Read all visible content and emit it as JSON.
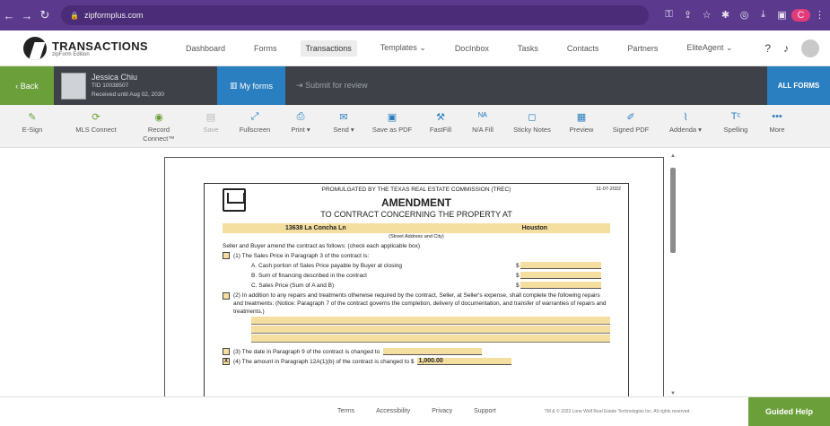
{
  "browser": {
    "url": "zipformplus.com",
    "profile_initial": "C"
  },
  "header": {
    "brand_title": "TRANSACTIONS",
    "brand_subtitle": "zipForm Edition",
    "nav": [
      "Dashboard",
      "Forms",
      "Transactions",
      "Templates",
      "DocInbox",
      "Tasks",
      "Contacts",
      "Partners",
      "EliteAgent"
    ],
    "active_nav": "Transactions"
  },
  "form_bar": {
    "back_label": "Back",
    "user_name": "Jessica Chiu",
    "user_id": "TID 10038507",
    "received_line": "Received until Aug 02, 2030",
    "my_forms_label": "My forms",
    "submit_label": "Submit for review",
    "all_forms_label": "ALL FORMS"
  },
  "toolbar": {
    "tools": [
      {
        "label": "E-Sign",
        "icon": "pen-icon"
      },
      {
        "label": "MLS Connect",
        "icon": "mls-icon"
      },
      {
        "label": "Record",
        "sub": "Connect™",
        "icon": "record-icon"
      },
      {
        "label": "Save",
        "icon": "save-icon"
      },
      {
        "label": "Fullscreen",
        "icon": "fullscreen-icon"
      },
      {
        "label": "Print",
        "icon": "print-icon"
      },
      {
        "label": "Send",
        "icon": "send-icon"
      },
      {
        "label": "Save as PDF",
        "icon": "pdf-icon"
      },
      {
        "label": "FastFill",
        "icon": "wrench-icon"
      },
      {
        "label": "N/A Fill",
        "icon": "na-icon"
      },
      {
        "label": "Sticky Notes",
        "icon": "note-icon"
      },
      {
        "label": "Preview",
        "icon": "preview-icon"
      },
      {
        "label": "Signed PDF",
        "icon": "signed-icon"
      },
      {
        "label": "Addenda",
        "icon": "clip-icon"
      },
      {
        "label": "Spelling",
        "icon": "spell-icon"
      },
      {
        "label": "More",
        "icon": "more-icon"
      }
    ]
  },
  "document": {
    "promulgated": "PROMULGATED BY THE TEXAS REAL ESTATE COMMISSION (TREC)",
    "form_date": "11-07-2022",
    "title": "AMENDMENT",
    "subtitle": "TO CONTRACT CONCERNING THE PROPERTY AT",
    "street": "13638 La Concha Ln",
    "city": "Houston",
    "address_caption": "(Street Address and City)",
    "intro": "Seller and Buyer amend the contract as follows: (check each applicable box)",
    "item1": "(1)  The Sales Price in Paragraph 3 of the contract is:",
    "item1a": "A.   Cash portion of Sales Price payable by Buyer at closing",
    "item1b": "B.   Sum of financing described in the contract",
    "item1c": "C.   Sales Price (Sum of A and B)",
    "item2": "(2)  In addition to any repairs and treatments otherwise required by the contract, Seller, at Seller's expense, shall complete the following repairs and treatments: (Notice: Paragraph 7 of the contract governs the completion, delivery of documentation, and transfer of warranties of repairs and treatments.)",
    "item3": "(3)  The date in Paragraph 9 of the contract is changed to",
    "item4": "(4)  The amount in Paragraph 12A(1)(b) of the contract is changed to $",
    "item4_value": "1,000.00",
    "item4_checked": "X"
  },
  "footer": {
    "links": [
      "Terms",
      "Accessibility",
      "Privacy",
      "Support"
    ],
    "copyright": "TM & © 2023 Lone Wolf Real Estate Technologies Inc. All rights reserved.",
    "guided_help": "Guided Help"
  }
}
